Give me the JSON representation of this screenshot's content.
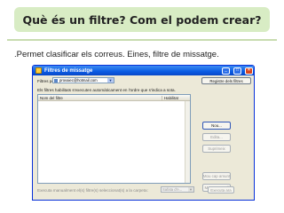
{
  "slide": {
    "title": "Què és un filtre? Com el podem crear?",
    "bullet": ".Permet clasificar els correus. Eines, filtre de missatge."
  },
  "window": {
    "title": "Filtres de missatge",
    "accent_color": "#0a5be3",
    "filters_for_label": "Filtres per a:",
    "account": "provaiec@hotmail.com",
    "log_button": "Registre dels filtres",
    "description": "Els filtres habilitats s'executen automàticament en l'ordre que s'indica a sota.",
    "columns": {
      "name": "Nom del filtre",
      "enabled": "Habilitat"
    },
    "buttons": {
      "new": "Nou...",
      "edit": "Edita...",
      "delete": "Suprimeix",
      "move_up": "Mou cap amunt",
      "move_down": "Mou cap avall",
      "run_now": "Executa ara"
    },
    "bottom_label": "Executa manualment el(s) filtre(s) seleccionat(s) a la carpeta:",
    "bottom_folder": "Safata d'e..."
  }
}
